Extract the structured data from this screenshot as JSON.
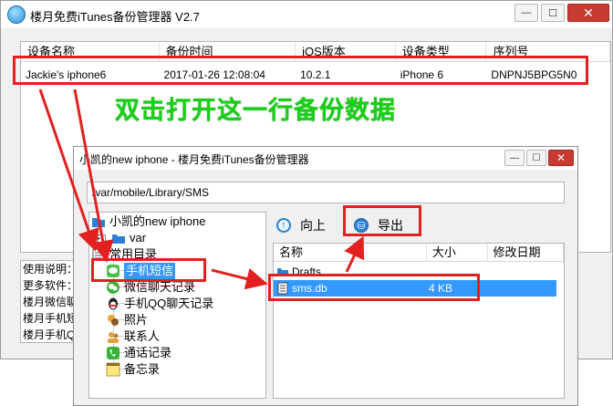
{
  "main_window": {
    "title": "楼月免费iTunes备份管理器 V2.7",
    "buttons": {
      "minimize": "—",
      "maximize": "☐",
      "close": "✕"
    },
    "columns": [
      "设备名称",
      "备份时间",
      "iOS版本",
      "设备类型",
      "序列号"
    ],
    "rows": [
      [
        "Jackie's iphone6",
        "2017-01-26 12:08:04",
        "10.2.1",
        "iPhone 6",
        "DNPNJ5BPG5N0"
      ]
    ],
    "info_lines": [
      "使用说明：",
      "更多软件：",
      "楼月微信聊",
      "楼月手机短",
      "楼月手机QQ"
    ]
  },
  "annotation": {
    "text": "双击打开这一行备份数据",
    "color": "#17d017",
    "highlight_color": "#e32020"
  },
  "dialog": {
    "title": "小凯的new iphone - 楼月免费iTunes备份管理器",
    "buttons": {
      "minimize": "—",
      "maximize": "☐",
      "close": "✕"
    },
    "path": "/var/mobile/Library/SMS",
    "tree": {
      "root": "小凯的new iphone",
      "var": "var",
      "common": "常用目录",
      "items": [
        "手机短信",
        "微信聊天记录",
        "手机QQ聊天记录",
        "照片",
        "联系人",
        "通话记录",
        "备忘录"
      ],
      "selected": "手机短信"
    },
    "toolbar": {
      "up_label": "向上",
      "export_label": "导出"
    },
    "file_columns": [
      "名称",
      "大小",
      "修改日期"
    ],
    "files": [
      {
        "name": "Drafts",
        "size": "",
        "type": "folder"
      },
      {
        "name": "sms.db",
        "size": "4 KB",
        "type": "file",
        "selected": true
      }
    ]
  },
  "icons": {
    "app": "itunes-backup-icon",
    "up": "up-arrow-icon",
    "export": "save-icon",
    "folder": "folder-icon",
    "db_file": "database-file-icon"
  }
}
